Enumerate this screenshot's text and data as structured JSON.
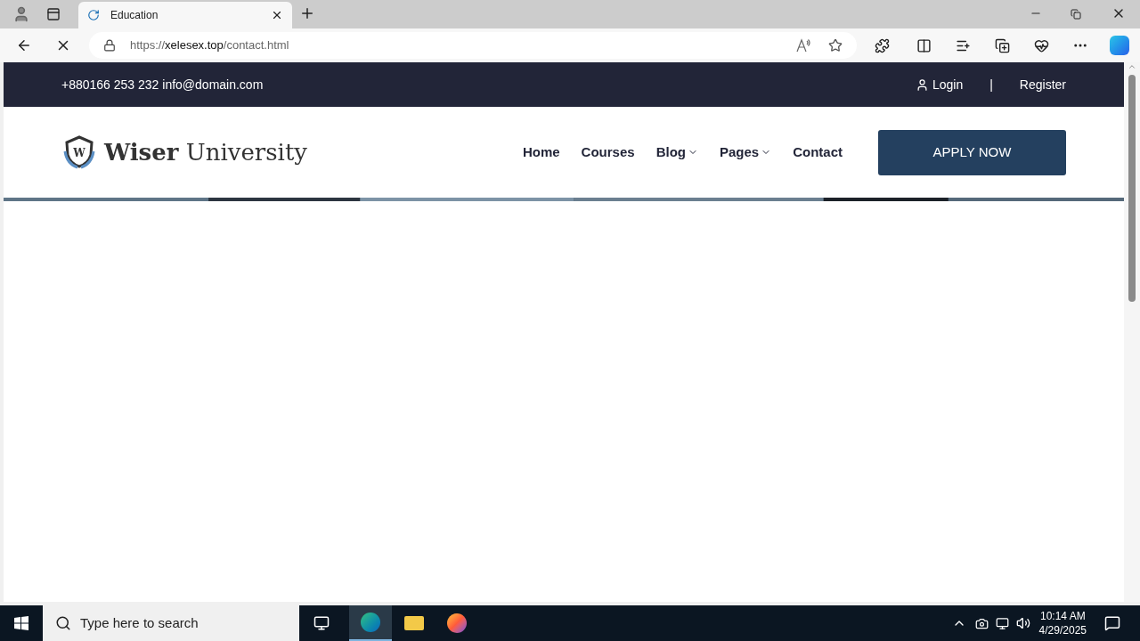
{
  "browser": {
    "tab": {
      "title": "Education",
      "loading": true
    },
    "url": {
      "scheme": "https://",
      "host": "xelesex.top",
      "path": "/contact.html"
    }
  },
  "topbar": {
    "contact": "+880166 253 232 info@domain.com",
    "login": "Login",
    "separator": "|",
    "register": "Register"
  },
  "header": {
    "logo_bold": "Wiser",
    "logo_rest": "University",
    "logo_letter": "W",
    "nav": [
      {
        "label": "Home",
        "has_menu": false
      },
      {
        "label": "Courses",
        "has_menu": false
      },
      {
        "label": "Blog",
        "has_menu": true
      },
      {
        "label": "Pages",
        "has_menu": true
      },
      {
        "label": "Contact",
        "has_menu": false
      }
    ],
    "cta": "APPLY NOW"
  },
  "taskbar": {
    "search_placeholder": "Type here to search",
    "time": "10:14 AM",
    "date": "4/29/2025"
  }
}
